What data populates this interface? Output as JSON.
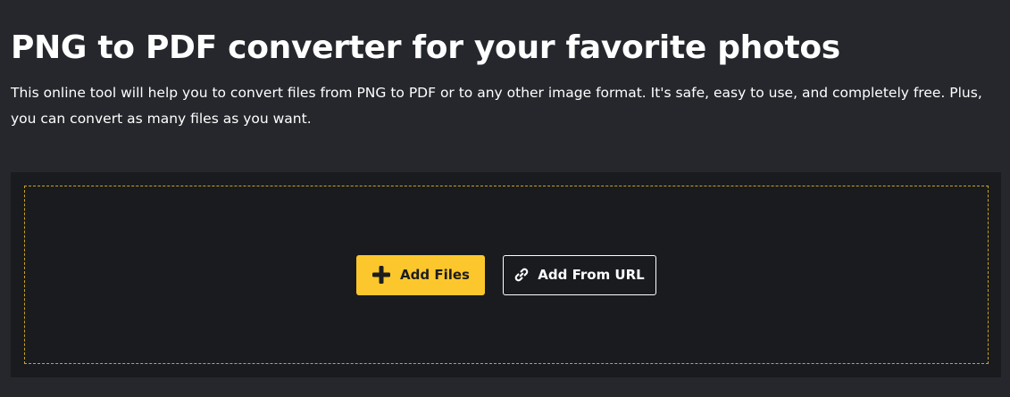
{
  "header": {
    "title": "PNG to PDF converter for your favorite photos",
    "description": "This online tool will help you to convert files from PNG to PDF or to any other image format. It's safe, easy to use, and completely free. Plus, you can convert as many files as you want."
  },
  "dropzone": {
    "add_files_label": "Add Files",
    "add_files_icon": "plus-icon",
    "add_url_label": "Add From URL",
    "add_url_icon": "link-icon"
  },
  "colors": {
    "background": "#25272c",
    "dropzone_background": "#191b1e",
    "dashed_border": "#c9a227",
    "accent": "#fcc72c"
  }
}
